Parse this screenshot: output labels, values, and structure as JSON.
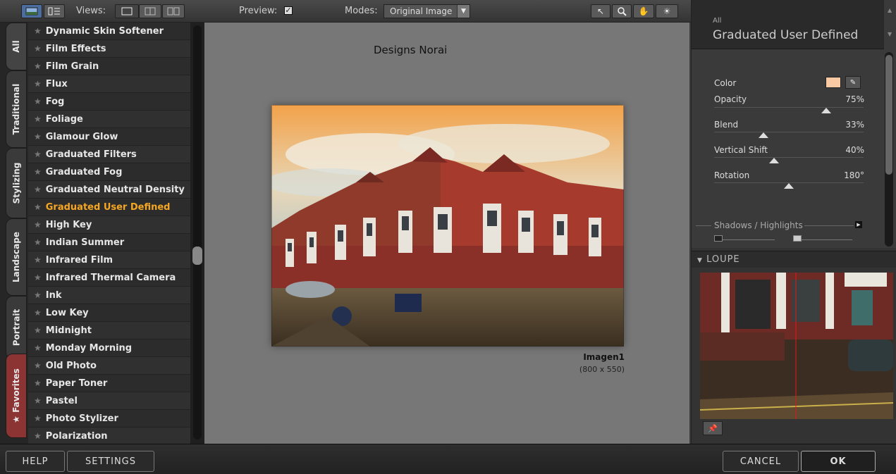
{
  "toolbar": {
    "views_label": "Views:",
    "preview_label": "Preview:",
    "preview_checked": true,
    "modes_label": "Modes:",
    "modes_value": "Original Image"
  },
  "tabs": [
    "All",
    "Traditional",
    "Stylizing",
    "Landscape",
    "Portrait",
    "Favorites"
  ],
  "filters": [
    {
      "label": "Dynamic Skin Softener",
      "active": false
    },
    {
      "label": "Film Effects",
      "active": false
    },
    {
      "label": "Film Grain",
      "active": false
    },
    {
      "label": "Flux",
      "active": false
    },
    {
      "label": "Fog",
      "active": false
    },
    {
      "label": "Foliage",
      "active": false
    },
    {
      "label": "Glamour Glow",
      "active": false
    },
    {
      "label": "Graduated Filters",
      "active": false
    },
    {
      "label": "Graduated Fog",
      "active": false
    },
    {
      "label": "Graduated Neutral Density",
      "active": false
    },
    {
      "label": "Graduated User Defined",
      "active": true
    },
    {
      "label": "High Key",
      "active": false
    },
    {
      "label": "Indian Summer",
      "active": false
    },
    {
      "label": "Infrared Film",
      "active": false
    },
    {
      "label": "Infrared Thermal Camera",
      "active": false
    },
    {
      "label": "Ink",
      "active": false
    },
    {
      "label": "Low Key",
      "active": false
    },
    {
      "label": "Midnight",
      "active": false
    },
    {
      "label": "Monday Morning",
      "active": false
    },
    {
      "label": "Old Photo",
      "active": false
    },
    {
      "label": "Paper Toner",
      "active": false
    },
    {
      "label": "Pastel",
      "active": false
    },
    {
      "label": "Photo Stylizer",
      "active": false
    },
    {
      "label": "Polarization",
      "active": false
    }
  ],
  "preview": {
    "title": "Designs Norai",
    "image_name": "Imagen1",
    "image_size": "(800 x 550)"
  },
  "panel": {
    "category": "All",
    "filter_name": "Graduated User Defined",
    "color_label": "Color",
    "color_value": "#f8c9a3",
    "params": [
      {
        "label": "Opacity",
        "value": "75%",
        "level": 0.75
      },
      {
        "label": "Blend",
        "value": "33%",
        "level": 0.33
      },
      {
        "label": "Vertical Shift",
        "value": "40%",
        "level": 0.4
      },
      {
        "label": "Rotation",
        "value": "180°",
        "level": 0.5
      }
    ],
    "shadows_highlights": "Shadows / Highlights",
    "loupe_title": "LOUPE"
  },
  "buttons": {
    "help": "HELP",
    "settings": "SETTINGS",
    "cancel": "CANCEL",
    "ok": "OK"
  },
  "colors": {
    "active_filter": "#f5a623",
    "favorites_tab": "#8c3434"
  }
}
